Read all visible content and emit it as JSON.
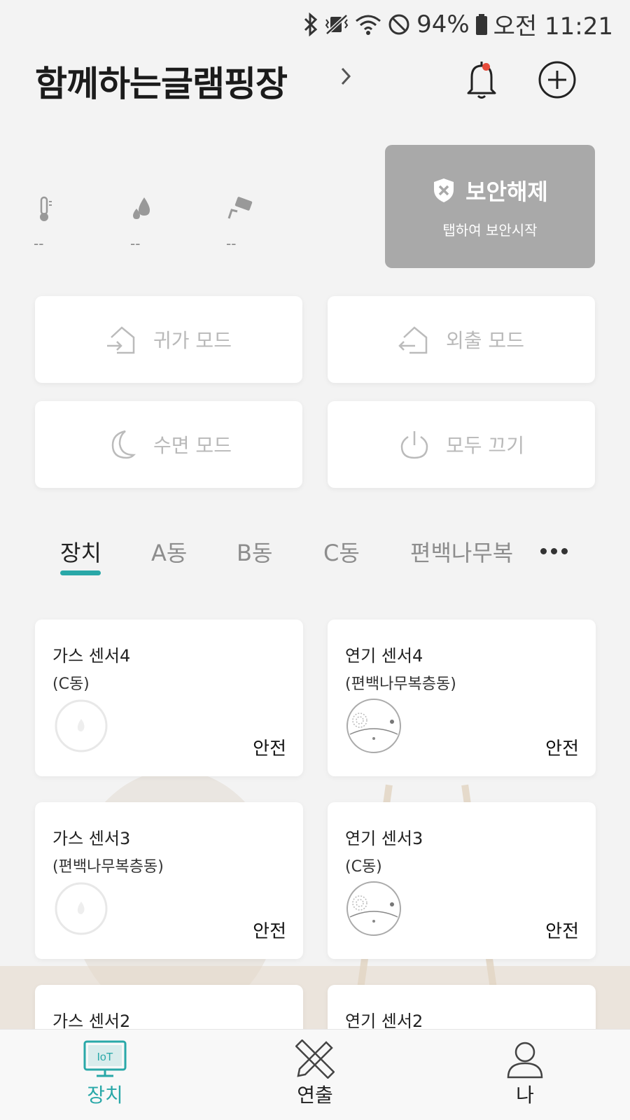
{
  "status_bar": {
    "battery_percent": "94%",
    "time": "오전 11:21",
    "icons": [
      "bluetooth-icon",
      "vibrate-mute-icon",
      "wifi-icon",
      "do-not-disturb-icon",
      "battery-icon"
    ]
  },
  "header": {
    "title": "함께하는글램핑장",
    "icons": [
      "chevron-right-icon",
      "bell-icon",
      "add-circle-icon"
    ],
    "notification_dot_color": "#e74c3c"
  },
  "readouts": {
    "temperature": "--",
    "humidity": "--",
    "camera": "--",
    "icons": [
      "thermometer-icon",
      "humidity-icon",
      "cctv-icon"
    ]
  },
  "security": {
    "title": "보안해제",
    "subtitle": "탭하여 보안시작",
    "icon": "shield-x-icon",
    "bg_color": "#a9a9a9"
  },
  "modes": [
    {
      "label": "귀가 모드",
      "icon": "home-in-icon"
    },
    {
      "label": "외출 모드",
      "icon": "home-out-icon"
    },
    {
      "label": "수면 모드",
      "icon": "moon-icon"
    },
    {
      "label": "모두 끄기",
      "icon": "power-icon"
    }
  ],
  "tabs": [
    {
      "label": "장치",
      "active": true
    },
    {
      "label": "A동",
      "active": false
    },
    {
      "label": "B동",
      "active": false
    },
    {
      "label": "C동",
      "active": false
    },
    {
      "label": "편백나무복",
      "active": false
    }
  ],
  "accent_color": "#29a8a8",
  "devices": [
    {
      "name": "가스 센서4",
      "location": "(C동)",
      "status": "안전",
      "type": "gas"
    },
    {
      "name": "연기 센서4",
      "location": "(편백나무복층동)",
      "status": "안전",
      "type": "smoke"
    },
    {
      "name": "가스 센서3",
      "location": "(편백나무복층동)",
      "status": "안전",
      "type": "gas"
    },
    {
      "name": "연기 센서3",
      "location": "(C동)",
      "status": "안전",
      "type": "smoke"
    },
    {
      "name": "가스 센서2",
      "location": "",
      "status": "",
      "type": "gas"
    },
    {
      "name": "연기 센서2",
      "location": "",
      "status": "",
      "type": "smoke"
    }
  ],
  "bottom_nav": [
    {
      "label": "장치",
      "icon": "iot-monitor-icon",
      "icon_text": "IoT",
      "active": true
    },
    {
      "label": "연출",
      "icon": "pencil-ruler-icon",
      "active": false
    },
    {
      "label": "나",
      "icon": "person-icon",
      "active": false
    }
  ]
}
